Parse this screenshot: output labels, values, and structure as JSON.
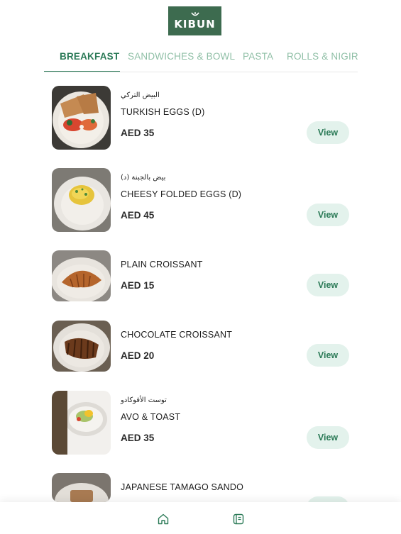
{
  "brand": {
    "logo_text": "KIBUN",
    "accent": "#2b7a57",
    "logo_bg": "#3d6b4f"
  },
  "tabs": [
    {
      "label": "BREAKFAST",
      "active": true
    },
    {
      "label": "SANDWICHES & BOWL",
      "active": false
    },
    {
      "label": "PASTA",
      "active": false
    },
    {
      "label": "ROLLS & NIGIRI",
      "active": false
    }
  ],
  "menu": {
    "view_label": "View",
    "items": [
      {
        "arabic": "البيض التركي",
        "name": "TURKISH EGGS (D)",
        "price": "AED 35",
        "image": "turkish-eggs-photo"
      },
      {
        "arabic": "بيض بالجبنة (د)",
        "name": "CHEESY FOLDED EGGS (D)",
        "price": "AED 45",
        "image": "cheesy-eggs-photo"
      },
      {
        "arabic": "",
        "name": "PLAIN CROISSANT",
        "price": "AED 15",
        "image": "plain-croissant-photo"
      },
      {
        "arabic": "",
        "name": "CHOCOLATE CROISSANT",
        "price": "AED 20",
        "image": "chocolate-croissant-photo"
      },
      {
        "arabic": "توست الأفوكادو",
        "name": "AVO & TOAST",
        "price": "AED 35",
        "image": "avo-toast-photo"
      },
      {
        "arabic": "",
        "name": "JAPANESE TAMAGO SANDO",
        "price": "",
        "image": "tamago-sando-photo"
      }
    ]
  },
  "bottom_nav": [
    {
      "icon": "home-icon"
    },
    {
      "icon": "menu-book-icon"
    }
  ]
}
